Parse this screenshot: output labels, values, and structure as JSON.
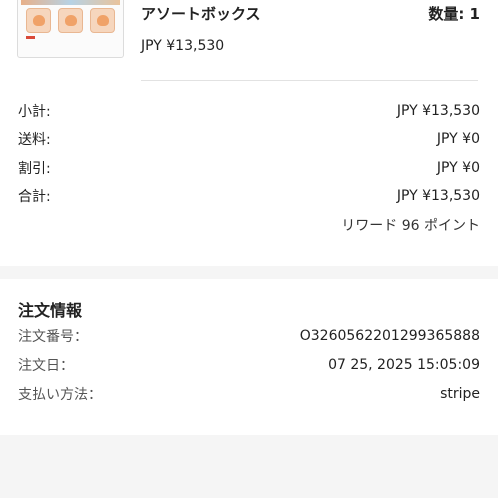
{
  "product": {
    "title": "アソートボックス",
    "quantity": "数量: 1",
    "price": "JPY ¥13,530"
  },
  "summary": {
    "subtotal_label": "小計:",
    "subtotal_value": "JPY ¥13,530",
    "shipping_label": "送料:",
    "shipping_value": "JPY ¥0",
    "discount_label": "割引:",
    "discount_value": "JPY ¥0",
    "total_label": "合計:",
    "total_value": "JPY ¥13,530",
    "reward_text": "リワード 96 ポイント"
  },
  "order_info": {
    "heading": "注文情報",
    "number_label": "注文番号：",
    "number_value": "O3260562201299365888",
    "date_label": "注文日：",
    "date_value": "07 25, 2025 15:05:09",
    "payment_label": "支払い方法：",
    "payment_value": "stripe"
  }
}
